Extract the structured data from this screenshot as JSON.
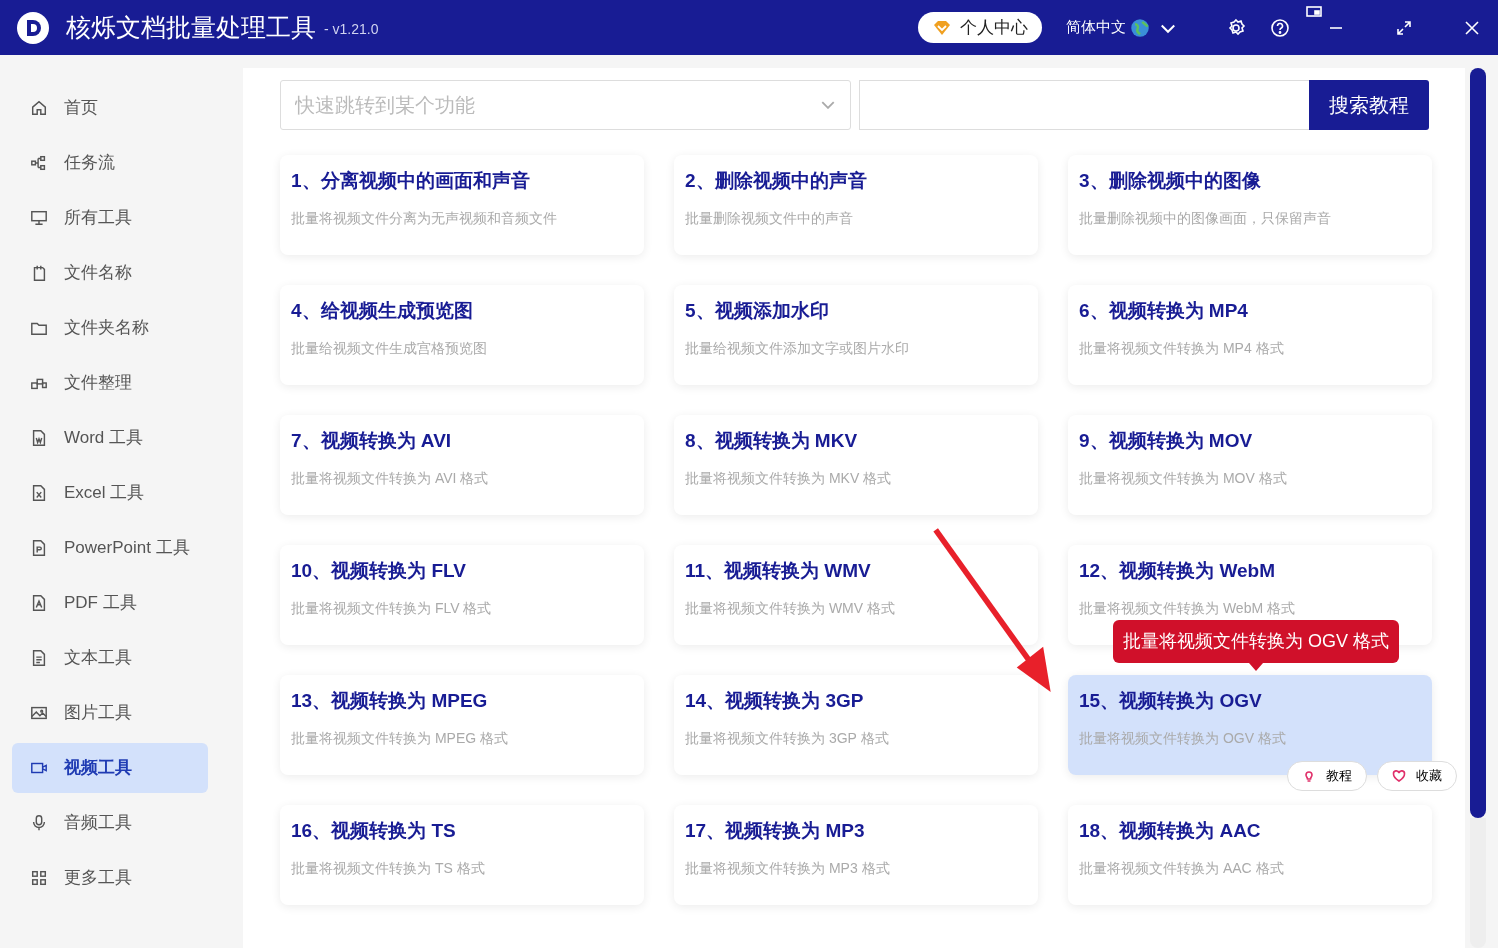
{
  "window": {
    "title": "核烁文档批量处理工具",
    "version": "- v1.21.0",
    "user_center": "个人中心",
    "language": "简体中文"
  },
  "sidebar": {
    "items": [
      {
        "label": "首页",
        "selected": false
      },
      {
        "label": "任务流",
        "selected": false
      },
      {
        "label": "所有工具",
        "selected": false
      },
      {
        "label": "文件名称",
        "selected": false
      },
      {
        "label": "文件夹名称",
        "selected": false
      },
      {
        "label": "文件整理",
        "selected": false
      },
      {
        "label": "Word 工具",
        "selected": false
      },
      {
        "label": "Excel 工具",
        "selected": false
      },
      {
        "label": "PowerPoint 工具",
        "selected": false
      },
      {
        "label": "PDF 工具",
        "selected": false
      },
      {
        "label": "文本工具",
        "selected": false
      },
      {
        "label": "图片工具",
        "selected": false
      },
      {
        "label": "视频工具",
        "selected": true
      },
      {
        "label": "音频工具",
        "selected": false
      },
      {
        "label": "更多工具",
        "selected": false
      }
    ]
  },
  "search": {
    "placeholder": "快速跳转到某个功能",
    "button": "搜索教程"
  },
  "tools": [
    {
      "title": "1、分离视频中的画面和声音",
      "description": "批量将视频文件分离为无声视频和音频文件",
      "selected": false
    },
    {
      "title": "2、删除视频中的声音",
      "description": "批量删除视频文件中的声音",
      "selected": false
    },
    {
      "title": "3、删除视频中的图像",
      "description": "批量删除视频中的图像画面，只保留声音",
      "selected": false
    },
    {
      "title": "4、给视频生成预览图",
      "description": "批量给视频文件生成宫格预览图",
      "selected": false
    },
    {
      "title": "5、视频添加水印",
      "description": "批量给视频文件添加文字或图片水印",
      "selected": false
    },
    {
      "title": "6、视频转换为 MP4",
      "description": "批量将视频文件转换为 MP4 格式",
      "selected": false
    },
    {
      "title": "7、视频转换为 AVI",
      "description": "批量将视频文件转换为 AVI 格式",
      "selected": false
    },
    {
      "title": "8、视频转换为 MKV",
      "description": "批量将视频文件转换为 MKV 格式",
      "selected": false
    },
    {
      "title": "9、视频转换为 MOV",
      "description": "批量将视频文件转换为 MOV 格式",
      "selected": false
    },
    {
      "title": "10、视频转换为 FLV",
      "description": "批量将视频文件转换为 FLV 格式",
      "selected": false
    },
    {
      "title": "11、视频转换为 WMV",
      "description": "批量将视频文件转换为 WMV 格式",
      "selected": false
    },
    {
      "title": "12、视频转换为 WebM",
      "description": "批量将视频文件转换为 WebM 格式",
      "selected": false
    },
    {
      "title": "13、视频转换为 MPEG",
      "description": "批量将视频文件转换为 MPEG 格式",
      "selected": false
    },
    {
      "title": "14、视频转换为 3GP",
      "description": "批量将视频文件转换为 3GP 格式",
      "selected": false
    },
    {
      "title": "15、视频转换为 OGV",
      "description": "批量将视频文件转换为 OGV 格式",
      "selected": true
    },
    {
      "title": "16、视频转换为 TS",
      "description": "批量将视频文件转换为 TS 格式",
      "selected": false
    },
    {
      "title": "17、视频转换为 MP3",
      "description": "批量将视频文件转换为 MP3 格式",
      "selected": false
    },
    {
      "title": "18、视频转换为 AAC",
      "description": "批量将视频文件转换为 AAC 格式",
      "selected": false
    }
  ],
  "tooltip": "批量将视频文件转换为 OGV 格式",
  "card_actions": [
    {
      "label": "教程",
      "kind": "tutorial"
    },
    {
      "label": "收藏",
      "kind": "favorite"
    }
  ]
}
